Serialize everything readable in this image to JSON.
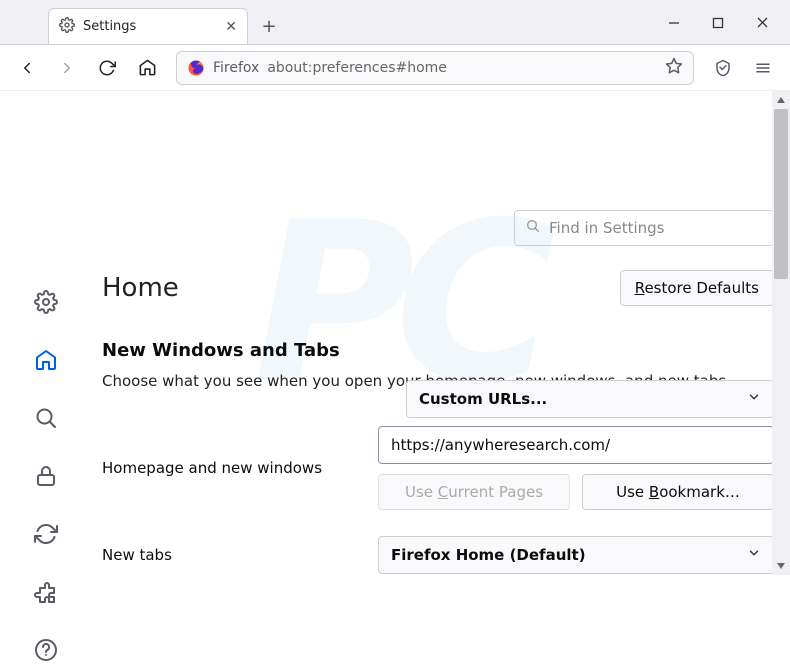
{
  "window": {
    "tab_title": "Settings",
    "newtab_tooltip": "+"
  },
  "toolbar": {
    "url_prefix": "Firefox",
    "url_path": "about:preferences#home"
  },
  "search": {
    "placeholder": "Find in Settings"
  },
  "page": {
    "title": "Home",
    "restore_btn": "Restore Defaults"
  },
  "section": {
    "heading": "New Windows and Tabs",
    "desc": "Choose what you see when you open your homepage, new windows, and new tabs."
  },
  "homepage": {
    "label": "Homepage and new windows",
    "select_value": "Custom URLs...",
    "url_value": "https://anywheresearch.com/",
    "use_current_pre": "Use ",
    "use_current_u": "C",
    "use_current_post": "urrent Pages",
    "use_bookmark_pre": "Use ",
    "use_bookmark_u": "B",
    "use_bookmark_post": "ookmark…"
  },
  "newtabs": {
    "label": "New tabs",
    "select_value": "Firefox Home (Default)"
  },
  "restore_u": "R",
  "restore_rest": "estore Defaults"
}
